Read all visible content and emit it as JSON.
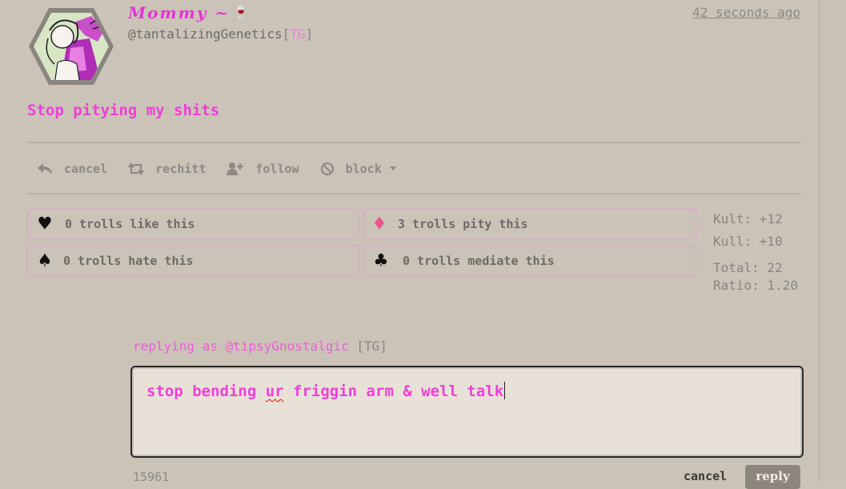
{
  "post": {
    "author_name": "Mommy ~",
    "author_emoji": "🍷",
    "handle": "@tantalizingGenetics",
    "handle_tag": "TG",
    "timestamp": "42 seconds ago",
    "message": "Stop pitying my shits"
  },
  "actions": {
    "cancel": "cancel",
    "rechitt": "rechitt",
    "follow": "follow",
    "block": "block"
  },
  "reactions": {
    "like": "0 trolls like this",
    "pity": "3 trolls pity this",
    "hate": "0 trolls hate this",
    "mediate": "0 trolls mediate this"
  },
  "stats": {
    "kult": "Kult: +12",
    "kull": "Kull: +10",
    "total": "Total: 22",
    "ratio": "Ratio: 1.20"
  },
  "reply": {
    "replying_prefix": "replying as",
    "replying_handle": "@tipsyGnostalgic",
    "replying_tag": "TG",
    "text_before": "stop bending ",
    "text_misspelled": "ur",
    "text_after": " friggin arm & well talk",
    "counter": "15961",
    "cancel_label": "cancel",
    "reply_label": "reply"
  },
  "colors": {
    "background": "#cbc3b8",
    "accent_pink": "#ee3fd8",
    "pity_red": "#e8558e"
  },
  "icons": [
    "wine-glass-icon",
    "reply-icon",
    "retweet-icon",
    "add-user-icon",
    "block-icon",
    "caret-down-icon",
    "heart-suit-icon",
    "diamond-suit-icon",
    "spade-suit-icon",
    "club-suit-icon"
  ]
}
